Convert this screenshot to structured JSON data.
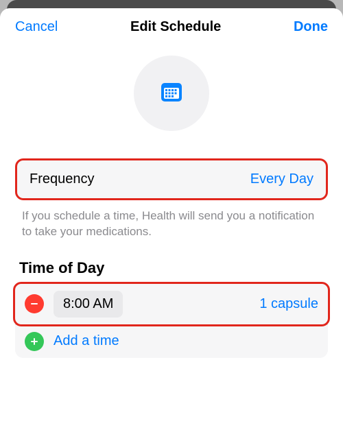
{
  "nav": {
    "cancel": "Cancel",
    "title": "Edit Schedule",
    "done": "Done"
  },
  "frequency": {
    "label": "Frequency",
    "value": "Every Day"
  },
  "helper_text": "If you schedule a time, Health will send you a notification to take your medications.",
  "time_of_day": {
    "title": "Time of Day",
    "entries": [
      {
        "time": "8:00 AM",
        "dose": "1 capsule"
      }
    ],
    "add_label": "Add a time"
  },
  "colors": {
    "accent": "#007aff",
    "destructive": "#ff3b30",
    "add": "#34c759",
    "highlight": "#e1261c"
  }
}
